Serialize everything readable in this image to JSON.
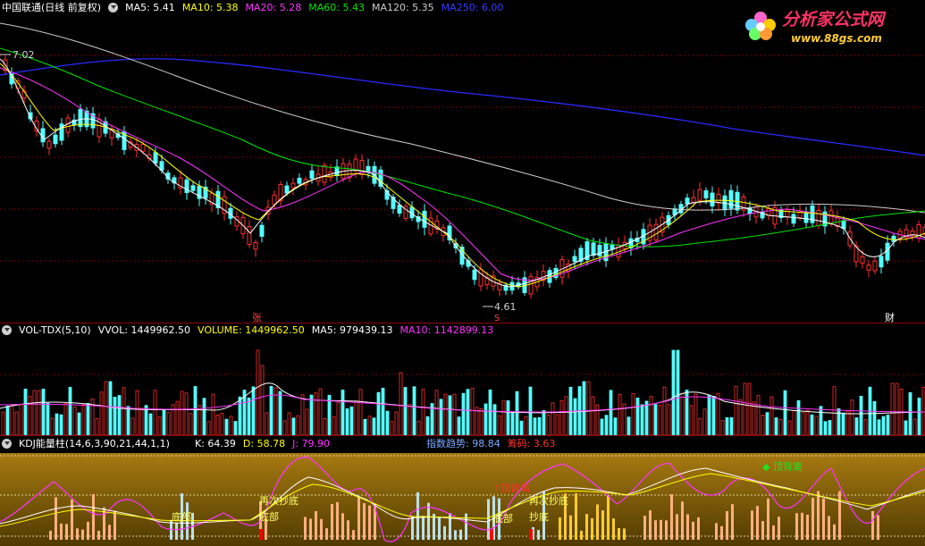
{
  "main_header": {
    "stock": "中国联通(日线 前复权)",
    "ma5": "MA5: 5.41",
    "ma10": "MA10: 5.38",
    "ma20": "MA20: 5.28",
    "ma60": "MA60: 5.43",
    "ma120": "MA120: 5.35",
    "ma250": "MA250: 6.00"
  },
  "logo": {
    "name": "分析家公式网",
    "url": "www.88gs.com"
  },
  "price_labels": {
    "high": "7.02",
    "low": "4.61"
  },
  "markers": {
    "zhang": "张",
    "cai": "财",
    "s": "S"
  },
  "vol_header": {
    "title": "VOL-TDX(5,10)",
    "vvol": "VVOL: 1449962.50",
    "volume": "VOLUME: 1449962.50",
    "ma5": "MA5: 979439.13",
    "ma10": "MA10: 1142899.13"
  },
  "kdj_header": {
    "title": "KDJ能量柱(14,6,3,90,21,44,1,1)",
    "k": "K: 64.39",
    "d": "D: 58.78",
    "j": "J: 79.90",
    "trend": "指数趋势: 98.84",
    "chips": "筹码: 3.63"
  },
  "kdj_labels": {
    "bottom1": "底部",
    "again1": "再次抄底",
    "bottom_a": "底部",
    "top_div": "顶背离",
    "bottom2": "底部",
    "again2": "再次抄底",
    "bottom_b": "抄底",
    "top_div2": "顶背离"
  },
  "colors": {
    "up": "#ff3030",
    "down": "#54ffff",
    "ma5": "#ffffff",
    "ma10": "#ffff00",
    "ma20": "#ff33ff",
    "ma60": "#00e600",
    "ma120": "#cccccc",
    "ma250": "#2020ff"
  }
}
